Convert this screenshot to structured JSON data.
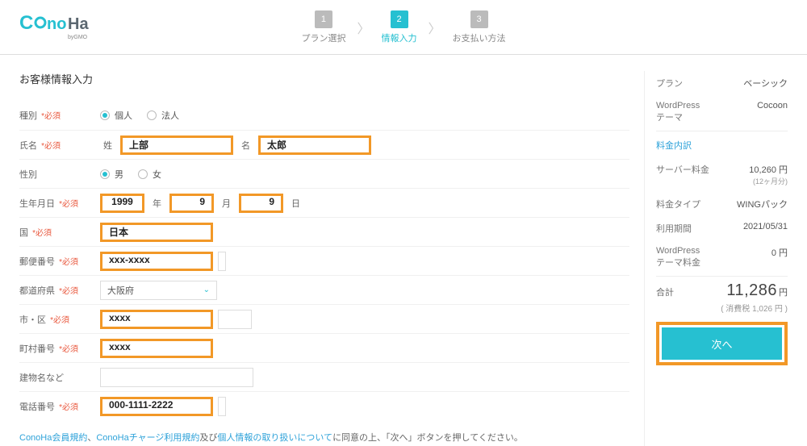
{
  "header": {
    "steps": [
      {
        "num": "1",
        "label": "プラン選択"
      },
      {
        "num": "2",
        "label": "情報入力"
      },
      {
        "num": "3",
        "label": "お支払い方法"
      }
    ]
  },
  "form": {
    "title": "お客様情報入力",
    "type_label": "種別",
    "type_options": {
      "personal": "個人",
      "corporate": "法人"
    },
    "name_label": "氏名",
    "name_last_prefix": "姓",
    "name_first_prefix": "名",
    "name_last": "上部",
    "name_first": "太郎",
    "gender_label": "性別",
    "gender_options": {
      "male": "男",
      "female": "女"
    },
    "birth_label": "生年月日",
    "birth_year": "1999",
    "birth_year_suffix": "年",
    "birth_month": "9",
    "birth_month_suffix": "月",
    "birth_day": "9",
    "birth_day_suffix": "日",
    "country_label": "国",
    "country": "日本",
    "postal_label": "郵便番号",
    "postal": "xxx-xxxx",
    "pref_label": "都道府県",
    "pref": "大阪府",
    "city_label": "市・区",
    "city": "xxxx",
    "town_label": "町村番号",
    "town": "xxxx",
    "building_label": "建物名など",
    "building": "",
    "phone_label": "電話番号",
    "phone": "000-1111-2222",
    "required_mark": "*必須",
    "agree_link1": "ConoHa会員規約",
    "agree_sep1": "、",
    "agree_link2": "ConoHaチャージ利用規約",
    "agree_sep2": "及び",
    "agree_link3": "個人情報の取り扱いについて",
    "agree_tail": "に同意の上、「次へ」ボタンを押してください。"
  },
  "summary": {
    "plan_label": "プラン",
    "plan_value": "ベーシック",
    "theme_label": "WordPress\nテーマ",
    "theme_value": "Cocoon",
    "fee_detail_link": "料金内訳",
    "server_label": "サーバー料金",
    "server_value": "10,260 円",
    "server_sub": "(12ヶ月分)",
    "fee_type_label": "料金タイプ",
    "fee_type_value": "WINGパック",
    "period_label": "利用期間",
    "period_value": "2021/05/31",
    "wp_fee_label": "WordPress\nテーマ料金",
    "wp_fee_value": "0 円",
    "total_label": "合計",
    "total_value": "11,286",
    "total_unit": "円",
    "tax": "( 消費税 1,026 円 )",
    "next": "次へ"
  }
}
